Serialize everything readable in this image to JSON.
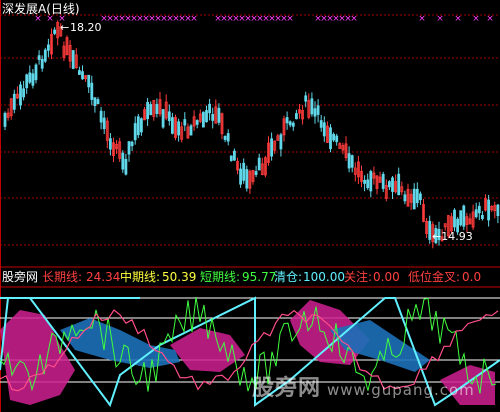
{
  "header": {
    "title": "深发展A(日线)"
  },
  "main_chart": {
    "high_label": "18.20",
    "low_label": "←14.93",
    "high_arrow": "←"
  },
  "indicator_bar": {
    "site": "股旁网",
    "long_label": "长期线: ",
    "long_value": "24.34",
    "mid_label": "中期线: ",
    "mid_value": "50.39",
    "short_label": "短期线: ",
    "short_value": "95.77",
    "clear_label": "清仓: ",
    "clear_value": "100.00",
    "watch_label": "关注: ",
    "watch_value": "0.00",
    "low_label": "低位金叉: ",
    "low_value": "0.0"
  },
  "watermark": {
    "text": "股旁网",
    "url": "www.gupang.com"
  },
  "colors": {
    "up": "#ff3b3b",
    "down": "#60d8ea",
    "grid": "#a00000",
    "marker": "#ff40ff",
    "cyan_line": "#60f0ff",
    "green_line": "#40ff40",
    "magenta_fill": "#d02090",
    "blue_fill": "#1c70b8"
  }
}
